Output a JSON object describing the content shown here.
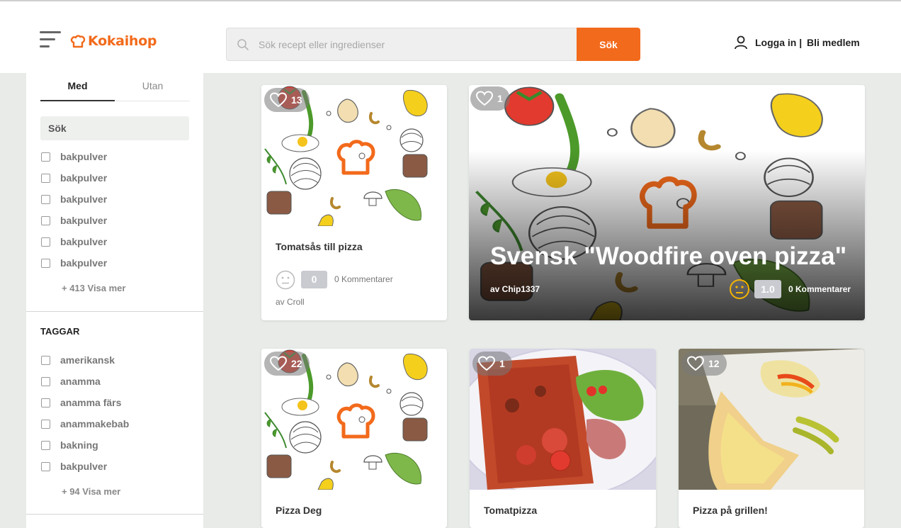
{
  "header": {
    "logo_text": "Kokaihop",
    "search_placeholder": "Sök recept eller ingredienser",
    "search_button": "Sök",
    "login_label": "Logga in |",
    "signup_label": "Bli medlem"
  },
  "sidebar": {
    "tabs": [
      {
        "label": "Med"
      },
      {
        "label": "Utan"
      }
    ],
    "filter_search_label": "Sök",
    "ingredients": [
      "bakpulver",
      "bakpulver",
      "bakpulver",
      "bakpulver",
      "bakpulver",
      "bakpulver"
    ],
    "ingredients_more": "+ 413 Visa mer",
    "tags_title": "TAGGAR",
    "tags": [
      "amerikansk",
      "anamma",
      "anamma färs",
      "anammakebab",
      "bakning",
      "bakpulver"
    ],
    "tags_more": "+ 94 Visa mer"
  },
  "cards": [
    {
      "title": "Tomatsås till pizza",
      "favorites": "13",
      "rating": "0",
      "comments": "0 Kommentarer",
      "author": "av Croll"
    },
    {
      "title": "Svensk \"Woodfire oven pizza\"",
      "favorites": "1",
      "rating": "1.0",
      "comments": "0 Kommentarer",
      "author": "av Chip1337"
    },
    {
      "title": "Pizza Deg",
      "favorites": "22"
    },
    {
      "title": "Tomatpizza",
      "favorites": "1"
    },
    {
      "title": "Pizza på grillen!",
      "favorites": "12"
    }
  ],
  "colors": {
    "accent": "#f26a1b",
    "rating_box": "#c9cbd1",
    "background": "#e8ebe8"
  }
}
